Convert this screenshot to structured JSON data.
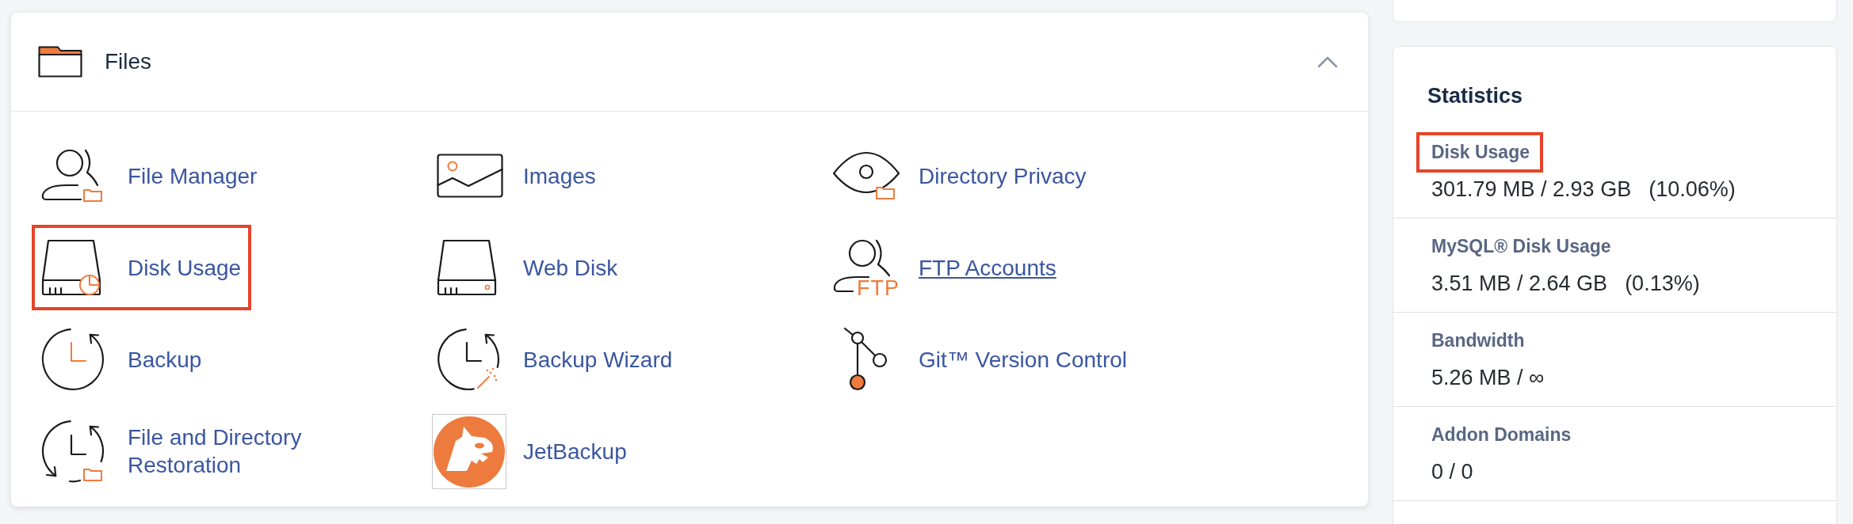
{
  "files": {
    "title": "Files",
    "expanded": true,
    "items": [
      {
        "label": "File Manager",
        "kind": "user",
        "highlighted": false,
        "hovered": false
      },
      {
        "label": "Images",
        "kind": "image",
        "highlighted": false,
        "hovered": false
      },
      {
        "label": "Directory Privacy",
        "kind": "eye",
        "highlighted": false,
        "hovered": false
      },
      {
        "label": "Disk Usage",
        "kind": "disk",
        "highlighted": true,
        "hovered": false
      },
      {
        "label": "Web Disk",
        "kind": "drive",
        "highlighted": false,
        "hovered": false
      },
      {
        "label": "FTP Accounts",
        "kind": "ftp",
        "icon_text": "FTP",
        "highlighted": false,
        "hovered": true
      },
      {
        "label": "Backup",
        "kind": "backup",
        "highlighted": false,
        "hovered": false
      },
      {
        "label": "Backup Wizard",
        "kind": "wizard",
        "highlighted": false,
        "hovered": false
      },
      {
        "label": "Git™ Version Control",
        "kind": "git",
        "highlighted": false,
        "hovered": false
      },
      {
        "label": "File and Directory Restoration",
        "kind": "restore",
        "highlighted": false,
        "hovered": false
      },
      {
        "label": "JetBackup",
        "kind": "logo",
        "highlighted": false,
        "hovered": false
      }
    ]
  },
  "statistics": {
    "title": "Statistics",
    "items": [
      {
        "label": "Disk Usage",
        "value": "301.79 MB / 2.93 GB",
        "percent": "(10.06%)",
        "highlighted": true
      },
      {
        "label": "MySQL® Disk Usage",
        "value": "3.51 MB / 2.64 GB",
        "percent": "(0.13%)",
        "highlighted": false
      },
      {
        "label": "Bandwidth",
        "value": "5.26 MB / ∞",
        "highlighted": false
      },
      {
        "label": "Addon Domains",
        "value": "0 / 0",
        "highlighted": false
      }
    ]
  }
}
